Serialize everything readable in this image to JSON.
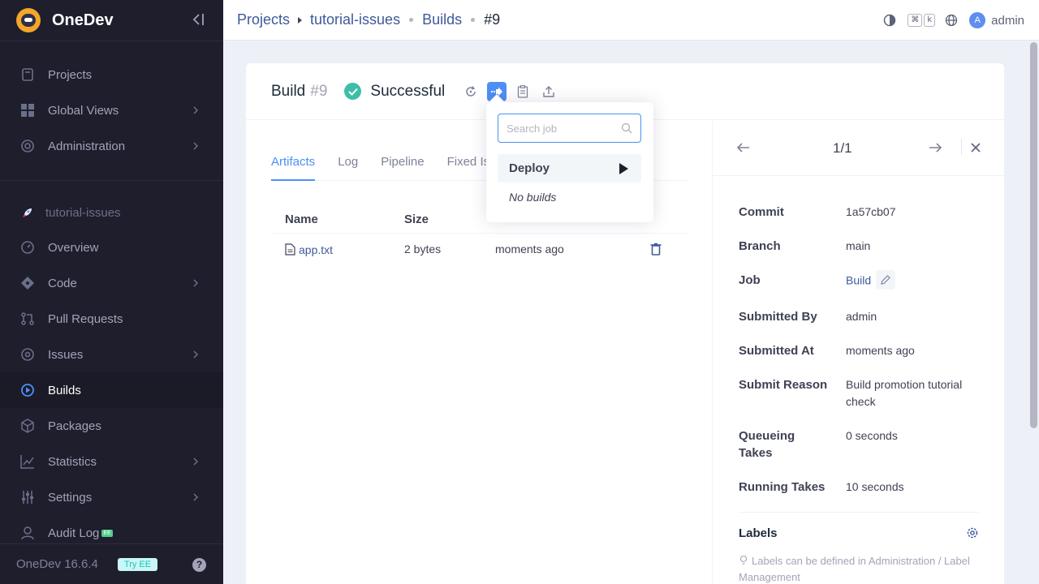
{
  "sidebar": {
    "brand": "OneDev",
    "top_items": [
      {
        "label": "Projects"
      },
      {
        "label": "Global Views"
      },
      {
        "label": "Administration"
      }
    ],
    "project": "tutorial-issues",
    "project_items": [
      {
        "label": "Overview"
      },
      {
        "label": "Code"
      },
      {
        "label": "Pull Requests"
      },
      {
        "label": "Issues"
      },
      {
        "label": "Builds"
      },
      {
        "label": "Packages"
      },
      {
        "label": "Statistics"
      },
      {
        "label": "Settings"
      },
      {
        "label": "Audit Log"
      }
    ],
    "ee_badge": "EE",
    "version": "OneDev 16.6.4",
    "try_ee": "Try EE",
    "help": "?"
  },
  "breadcrumb": [
    "Projects",
    "tutorial-issues",
    "Builds",
    "#9"
  ],
  "topbar": {
    "kbd1": "⌘",
    "kbd2": "k",
    "avatar_letter": "A",
    "user": "admin"
  },
  "build": {
    "title": "Build",
    "number": "#9",
    "status": "Successful",
    "status_color": "#3cbfa7"
  },
  "tabs": [
    "Artifacts",
    "Log",
    "Pipeline",
    "Fixed Is"
  ],
  "artifacts": {
    "columns": [
      "Name",
      "Size"
    ],
    "rows": [
      {
        "name": "app.txt",
        "size": "2 bytes",
        "modified": "moments ago"
      }
    ]
  },
  "pager": "1/1",
  "info": {
    "commit": {
      "label": "Commit",
      "value": "1a57cb07"
    },
    "branch": {
      "label": "Branch",
      "value": "main"
    },
    "job": {
      "label": "Job",
      "value": "Build"
    },
    "submitted_by": {
      "label": "Submitted By",
      "value": "admin"
    },
    "submitted_at": {
      "label": "Submitted At",
      "value": "moments ago"
    },
    "submit_reason": {
      "label": "Submit Reason",
      "value": "Build promotion tutorial check"
    },
    "queueing": {
      "label": "Queueing Takes",
      "value": "0 seconds"
    },
    "running": {
      "label": "Running Takes",
      "value": "10 seconds"
    }
  },
  "labels": {
    "title": "Labels",
    "hint": "Labels can be defined in Administration / Label Management"
  },
  "dropdown": {
    "search_placeholder": "Search job",
    "job": "Deploy",
    "empty": "No builds"
  },
  "colors": {
    "accent": "#4d8ff6",
    "sidebar_bg": "#1e1e2d"
  }
}
